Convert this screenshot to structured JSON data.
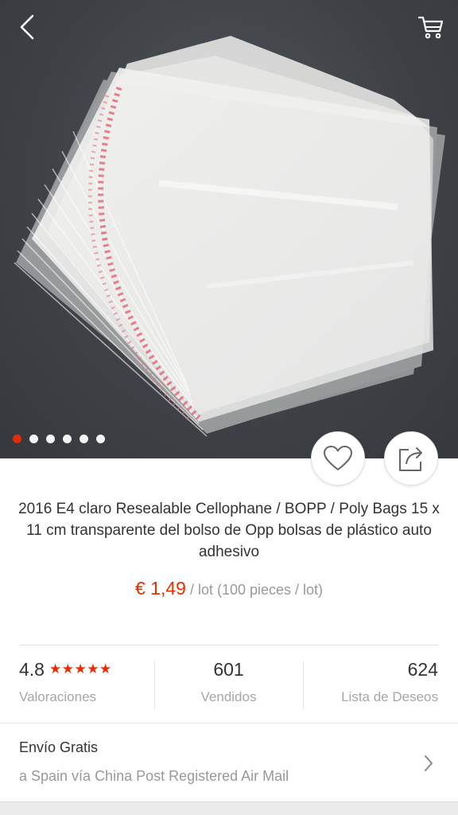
{
  "header": {
    "back_icon": "chevron-left-icon",
    "cart_icon": "cart-icon"
  },
  "gallery": {
    "image_count": 6,
    "active_index": 0
  },
  "actions": {
    "wishlist_icon": "heart-icon",
    "share_icon": "share-icon"
  },
  "product": {
    "title": "2016 E4 claro Resealable Cellophane / BOPP / Poly Bags 15 x 11 cm transparente del bolso de Opp bolsas de plástico auto adhesivo",
    "price": "€ 1,49",
    "unit": "/ lot (100 pieces / lot)"
  },
  "stats": {
    "rating_value": "4.8",
    "stars": "★★★★★",
    "rating_label": "Valoraciones",
    "sold_value": "601",
    "sold_label": "Vendidos",
    "wishlist_value": "624",
    "wishlist_label": "Lista de Deseos"
  },
  "shipping": {
    "title": "Envío Gratis",
    "detail": "a Spain vía China Post Registered Air Mail"
  },
  "colors": {
    "accent": "#e62e04",
    "muted_text": "#999999",
    "primary_text": "#333333"
  }
}
